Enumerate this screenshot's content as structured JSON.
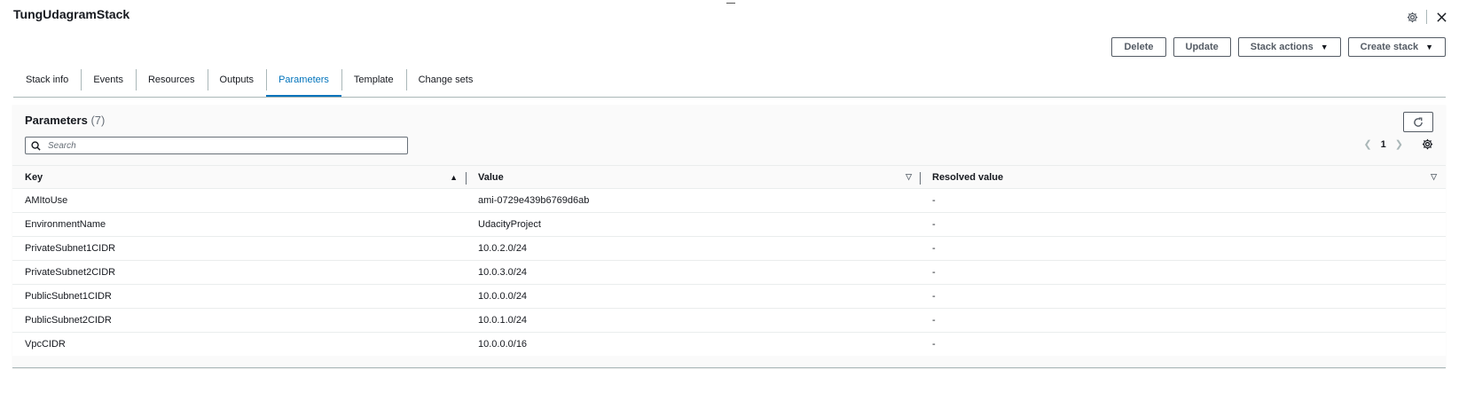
{
  "header": {
    "title": "TungUdagramStack"
  },
  "icons": {
    "settings": "gear-icon",
    "close": "close-icon"
  },
  "actions": {
    "delete": "Delete",
    "update": "Update",
    "stack_actions": "Stack actions",
    "create_stack": "Create stack"
  },
  "tabs": [
    {
      "label": "Stack info"
    },
    {
      "label": "Events"
    },
    {
      "label": "Resources"
    },
    {
      "label": "Outputs"
    },
    {
      "label": "Parameters"
    },
    {
      "label": "Template"
    },
    {
      "label": "Change sets"
    }
  ],
  "active_tab": "Parameters",
  "panel": {
    "title": "Parameters",
    "count": "(7)",
    "search_placeholder": "Search",
    "page": "1"
  },
  "table": {
    "columns": {
      "key": "Key",
      "value": "Value",
      "resolved": "Resolved value"
    },
    "rows": [
      {
        "key": "AMItoUse",
        "value": "ami-0729e439b6769d6ab",
        "resolved": "-"
      },
      {
        "key": "EnvironmentName",
        "value": "UdacityProject",
        "resolved": "-"
      },
      {
        "key": "PrivateSubnet1CIDR",
        "value": "10.0.2.0/24",
        "resolved": "-"
      },
      {
        "key": "PrivateSubnet2CIDR",
        "value": "10.0.3.0/24",
        "resolved": "-"
      },
      {
        "key": "PublicSubnet1CIDR",
        "value": "10.0.0.0/24",
        "resolved": "-"
      },
      {
        "key": "PublicSubnet2CIDR",
        "value": "10.0.1.0/24",
        "resolved": "-"
      },
      {
        "key": "VpcCIDR",
        "value": "10.0.0.0/16",
        "resolved": "-"
      }
    ]
  },
  "colors": {
    "accent": "#0073bb",
    "text": "#16191f",
    "border": "#aab7b8"
  }
}
